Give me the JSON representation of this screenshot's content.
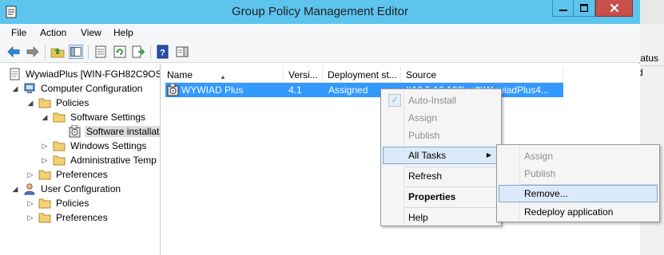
{
  "window": {
    "title": "Group Policy Management Editor"
  },
  "menubar": {
    "items": [
      "File",
      "Action",
      "View",
      "Help"
    ]
  },
  "background_window": {
    "col_header": "tatus",
    "col_value": "d"
  },
  "tree": {
    "root": "WywiadPlus [WIN-FGH82C9OSJ",
    "computer_config": "Computer Configuration",
    "cc_policies": "Policies",
    "software_settings": "Software Settings",
    "software_installation": "Software installat",
    "windows_settings": "Windows Settings",
    "admin_templates": "Administrative Temp",
    "cc_preferences": "Preferences",
    "user_config": "User Configuration",
    "uc_policies": "Policies",
    "uc_preferences": "Preferences"
  },
  "list": {
    "columns": [
      "Name",
      "Versi...",
      "Deployment st...",
      "Source"
    ],
    "rows": [
      {
        "name": "WYWIAD Plus",
        "version": "4.1",
        "deployment": "Assigned",
        "source": "\\\\10.5.16.160\\soft\\WywiadPlus4..."
      }
    ]
  },
  "context_menu": {
    "items": [
      "Auto-Install",
      "Assign",
      "Publish",
      "All Tasks",
      "Refresh",
      "Properties",
      "Help"
    ],
    "check_glyph": "✓",
    "submenu_arrow": "▶"
  },
  "submenu": {
    "items": [
      "Assign",
      "Publish",
      "Remove...",
      "Redeploy application"
    ]
  },
  "colors": {
    "titlebar": "#5cc4ed",
    "selection": "#3399ff",
    "close_button": "#c7504a",
    "menu_highlight": "#dbeaf8"
  }
}
